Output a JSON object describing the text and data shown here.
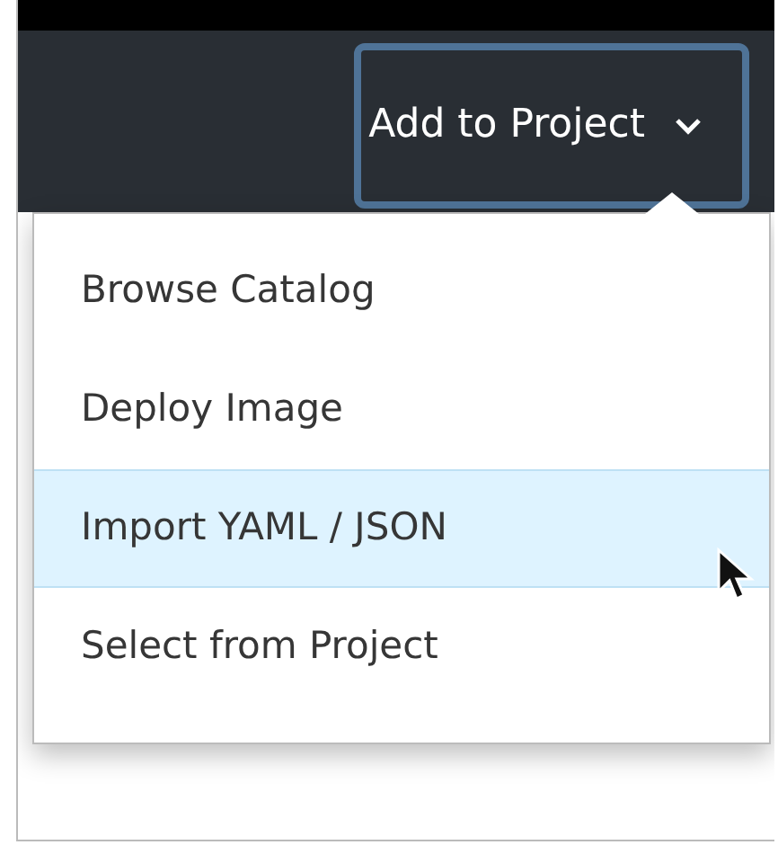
{
  "toolbar": {
    "button": {
      "label": "Add to Project",
      "expanded": true
    }
  },
  "menu": {
    "items": [
      {
        "label": "Browse Catalog",
        "selected": false
      },
      {
        "label": "Deploy Image",
        "selected": false
      },
      {
        "label": "Import YAML / JSON",
        "selected": true
      },
      {
        "label": "Select from Project",
        "selected": false
      }
    ]
  }
}
